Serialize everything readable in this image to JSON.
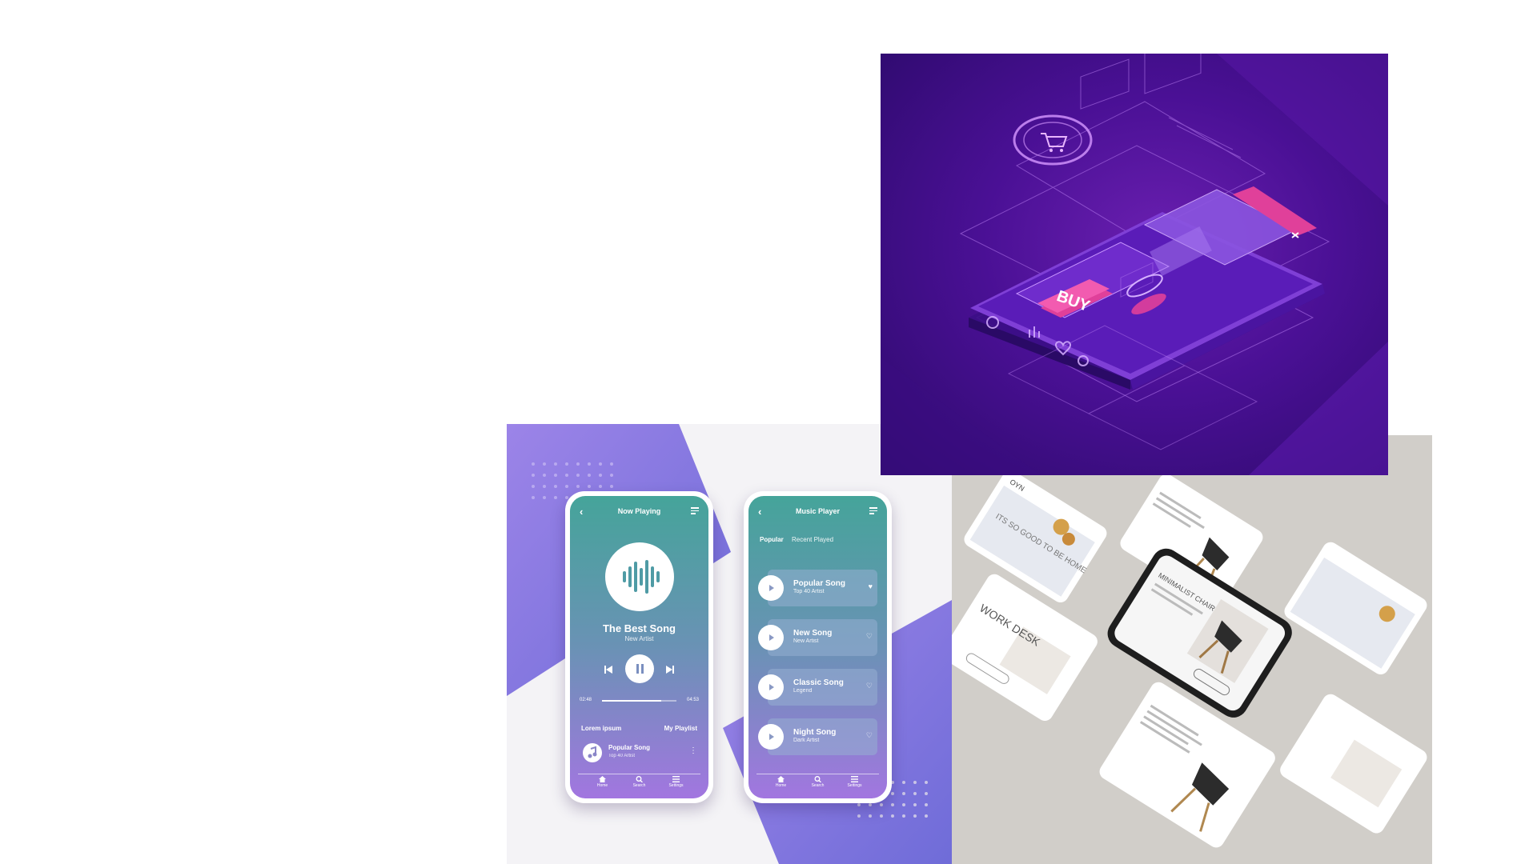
{
  "iso_illustration": {
    "buy_label": "BUY",
    "colors": {
      "background": "#4a1095",
      "accent": "#e0409a",
      "line": "#b77cf0"
    },
    "icons": [
      "cart-icon",
      "close-icon",
      "user-icon",
      "chart-icon",
      "heart-icon",
      "settings-icon"
    ]
  },
  "music_app": {
    "colors": {
      "gradient_top": "#45a49a",
      "gradient_bottom": "#a276e0",
      "background_shape": "#9a7fe0"
    },
    "now_playing": {
      "title": "Now Playing",
      "song_title": "The Best Song",
      "song_artist": "New Artist",
      "time_elapsed": "02:48",
      "time_total": "04:53",
      "progress": 0.8,
      "section_left": "Lorem ipsum",
      "section_right": "My Playlist",
      "mini_player": {
        "title": "Popular Song",
        "subtitle": "Top 40 Artist"
      },
      "nav": [
        "Home",
        "Search",
        "Settings"
      ]
    },
    "music_player": {
      "title": "Music Player",
      "tabs": [
        "Popular",
        "Recent Played"
      ],
      "songs": [
        {
          "title": "Popular Song",
          "subtitle": "Top 40 Artist"
        },
        {
          "title": "New Song",
          "subtitle": "New Artist"
        },
        {
          "title": "Classic Song",
          "subtitle": "Legend"
        },
        {
          "title": "Night Song",
          "subtitle": "Dark Artist"
        }
      ],
      "nav": [
        "Home",
        "Search",
        "Settings"
      ]
    }
  },
  "furniture_app": {
    "brand": "OYN",
    "headline_1": "ITS SO GOOD TO BE HOME",
    "headline_2": "WORK DESK",
    "headline_3": "MINIMALIST CHAIR"
  }
}
